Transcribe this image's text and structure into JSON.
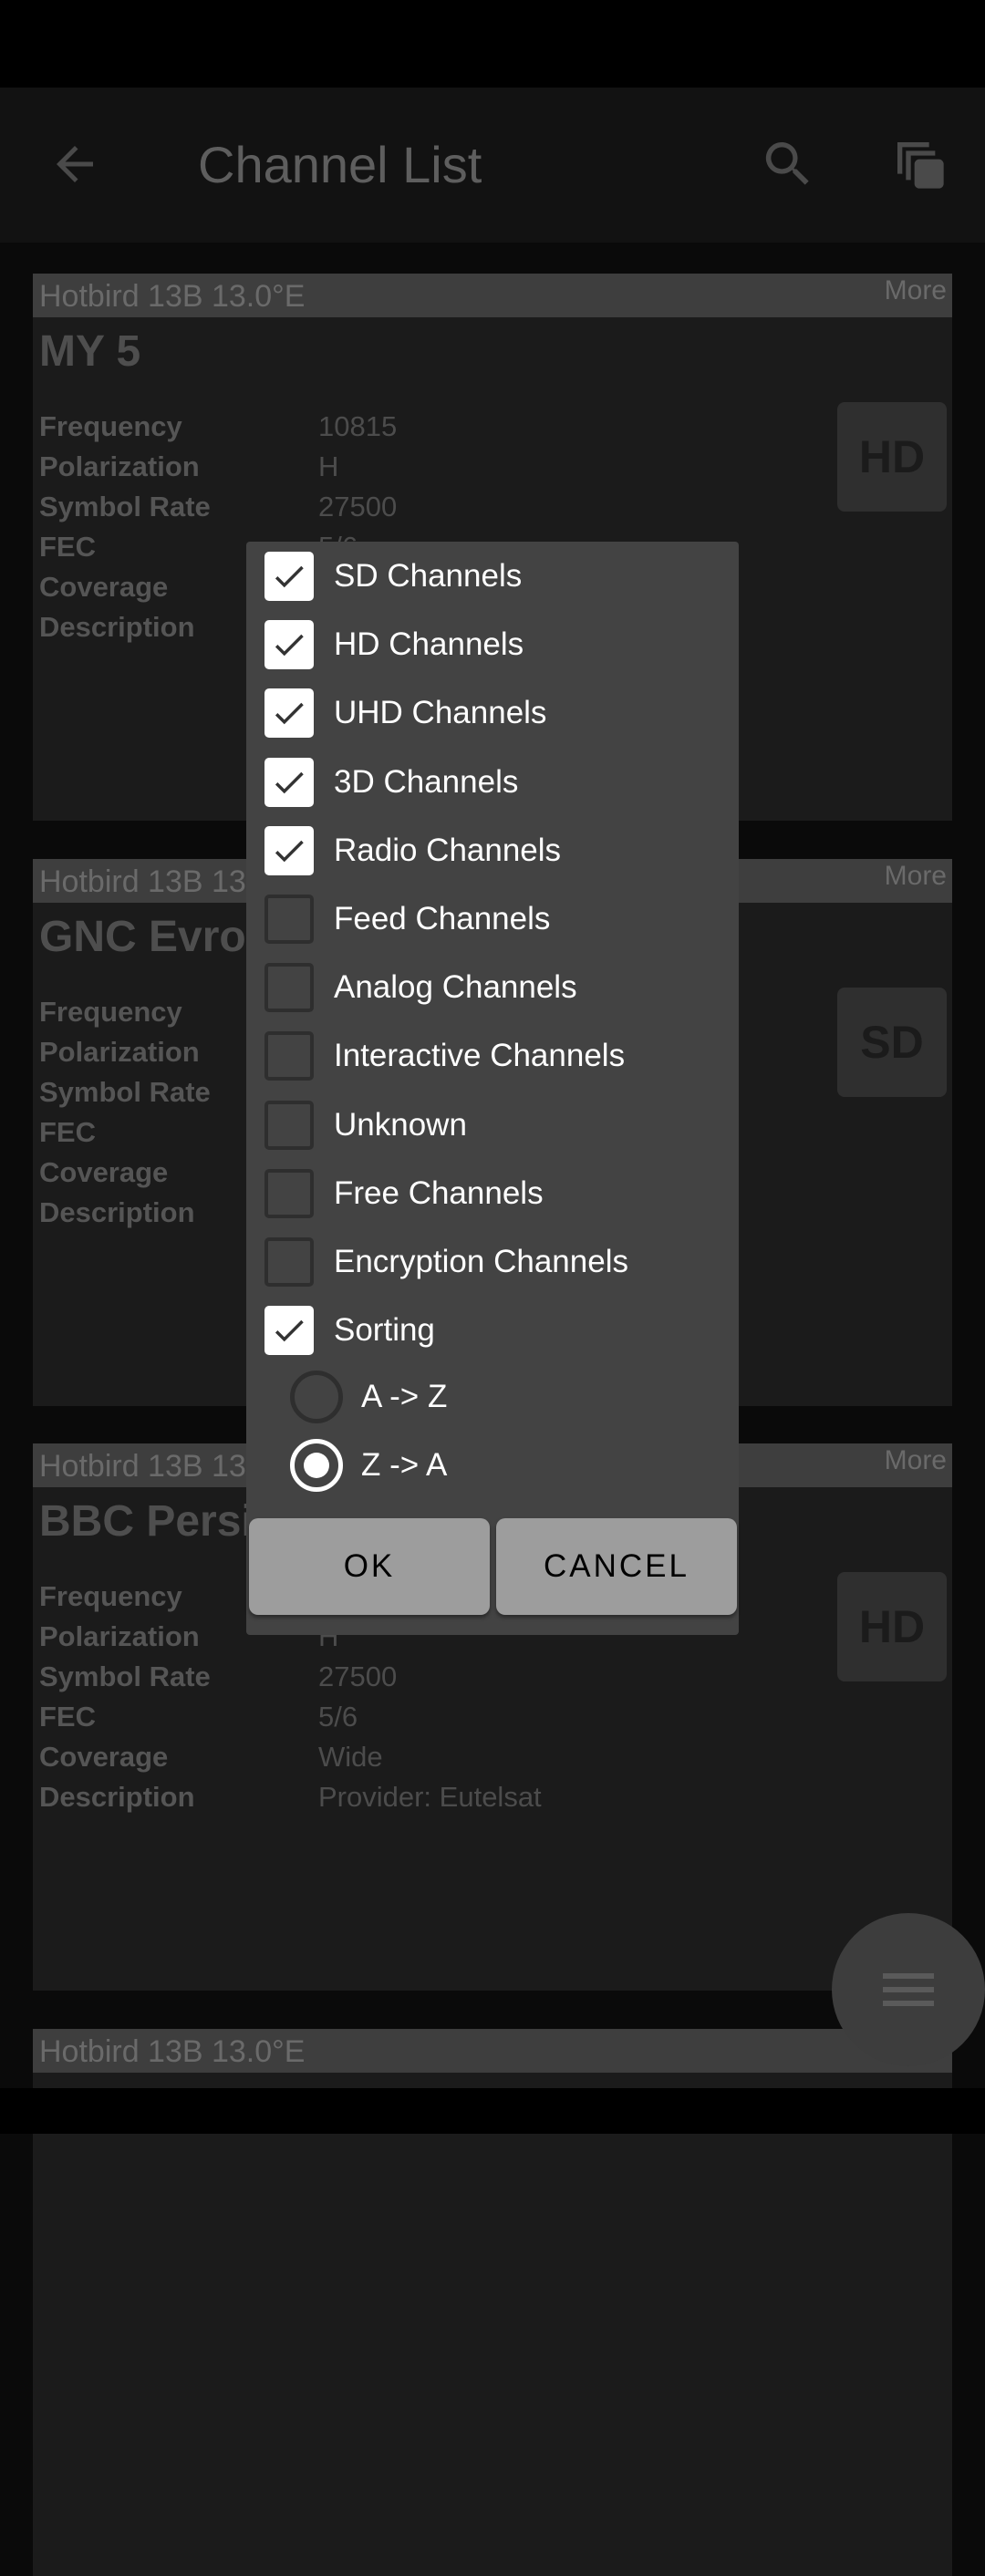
{
  "app_bar": {
    "title": "Channel List",
    "back_icon": "arrow-left-icon",
    "search_icon": "search-icon",
    "copy_icon": "copy-icon"
  },
  "cards": [
    {
      "satellite": "Hotbird 13B 13.0°E",
      "more": "More",
      "name": "MY 5",
      "badge": "HD",
      "rows": [
        {
          "label": "Frequency",
          "value": "10815"
        },
        {
          "label": "Polarization",
          "value": "H"
        },
        {
          "label": "Symbol Rate",
          "value": "27500"
        },
        {
          "label": "FEC",
          "value": "5/6"
        },
        {
          "label": "Coverage",
          "value": ""
        },
        {
          "label": "Description",
          "value": ""
        }
      ]
    },
    {
      "satellite": "Hotbird 13B 13",
      "more": "More",
      "name": "GNC Evrop",
      "badge": "SD",
      "rows": [
        {
          "label": "Frequency",
          "value": ""
        },
        {
          "label": "Polarization",
          "value": ""
        },
        {
          "label": "Symbol Rate",
          "value": ""
        },
        {
          "label": "FEC",
          "value": ""
        },
        {
          "label": "Coverage",
          "value": ""
        },
        {
          "label": "Description",
          "value": ""
        }
      ]
    },
    {
      "satellite": "Hotbird 13B 13",
      "more": "More",
      "name": "BBC Persi",
      "badge": "HD",
      "rows": [
        {
          "label": "Frequency",
          "value": ""
        },
        {
          "label": "Polarization",
          "value": "H"
        },
        {
          "label": "Symbol Rate",
          "value": "27500"
        },
        {
          "label": "FEC",
          "value": "5/6"
        },
        {
          "label": "Coverage",
          "value": "Wide"
        },
        {
          "label": "Description",
          "value": "Provider: Eutelsat"
        }
      ]
    },
    {
      "satellite": "Hotbird 13B 13.0°E"
    }
  ],
  "dialog": {
    "options": [
      {
        "label": "SD Channels",
        "checked": true
      },
      {
        "label": "HD Channels",
        "checked": true
      },
      {
        "label": "UHD Channels",
        "checked": true
      },
      {
        "label": "3D Channels",
        "checked": true
      },
      {
        "label": "Radio Channels",
        "checked": true
      },
      {
        "label": "Feed Channels",
        "checked": false
      },
      {
        "label": "Analog Channels",
        "checked": false
      },
      {
        "label": "Interactive Channels",
        "checked": false
      },
      {
        "label": "Unknown",
        "checked": false
      },
      {
        "label": "Free Channels",
        "checked": false
      },
      {
        "label": "Encryption Channels",
        "checked": false
      },
      {
        "label": "Sorting",
        "checked": true
      }
    ],
    "sort": [
      {
        "label": "A -> Z",
        "selected": false
      },
      {
        "label": "Z -> A",
        "selected": true
      }
    ],
    "ok": "OK",
    "cancel": "CANCEL"
  },
  "fab": {
    "icon": "menu-icon"
  }
}
